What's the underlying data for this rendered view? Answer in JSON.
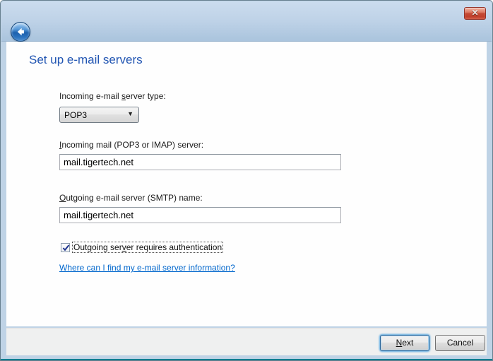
{
  "window": {
    "close_glyph": "✕"
  },
  "main": {
    "title": "Set up e-mail servers",
    "server_type": {
      "label_pre": "Incoming e-mail ",
      "label_key": "s",
      "label_post": "erver type:",
      "value": "POP3",
      "arrow_glyph": "▼"
    },
    "incoming": {
      "label_pre": "",
      "label_key": "I",
      "label_post": "ncoming mail (POP3 or IMAP) server:",
      "value": "mail.tigertech.net"
    },
    "outgoing": {
      "label_pre": "",
      "label_key": "O",
      "label_post": "utgoing e-mail server (SMTP) name:",
      "value": "mail.tigertech.net"
    },
    "auth_checkbox": {
      "checked": true,
      "label_pre": "Outgoing ser",
      "label_key": "v",
      "label_post": "er requires authentication"
    },
    "help_link": "Where can I find my e-mail server information?"
  },
  "footer": {
    "next_pre": "",
    "next_key": "N",
    "next_post": "ext",
    "cancel_label": "Cancel"
  },
  "colors": {
    "title_text": "#2155b2",
    "link": "#0066cc",
    "header_blue": "#bed2e7",
    "close_red": "#c44a35",
    "frame_blue": "#bfd3e6"
  }
}
